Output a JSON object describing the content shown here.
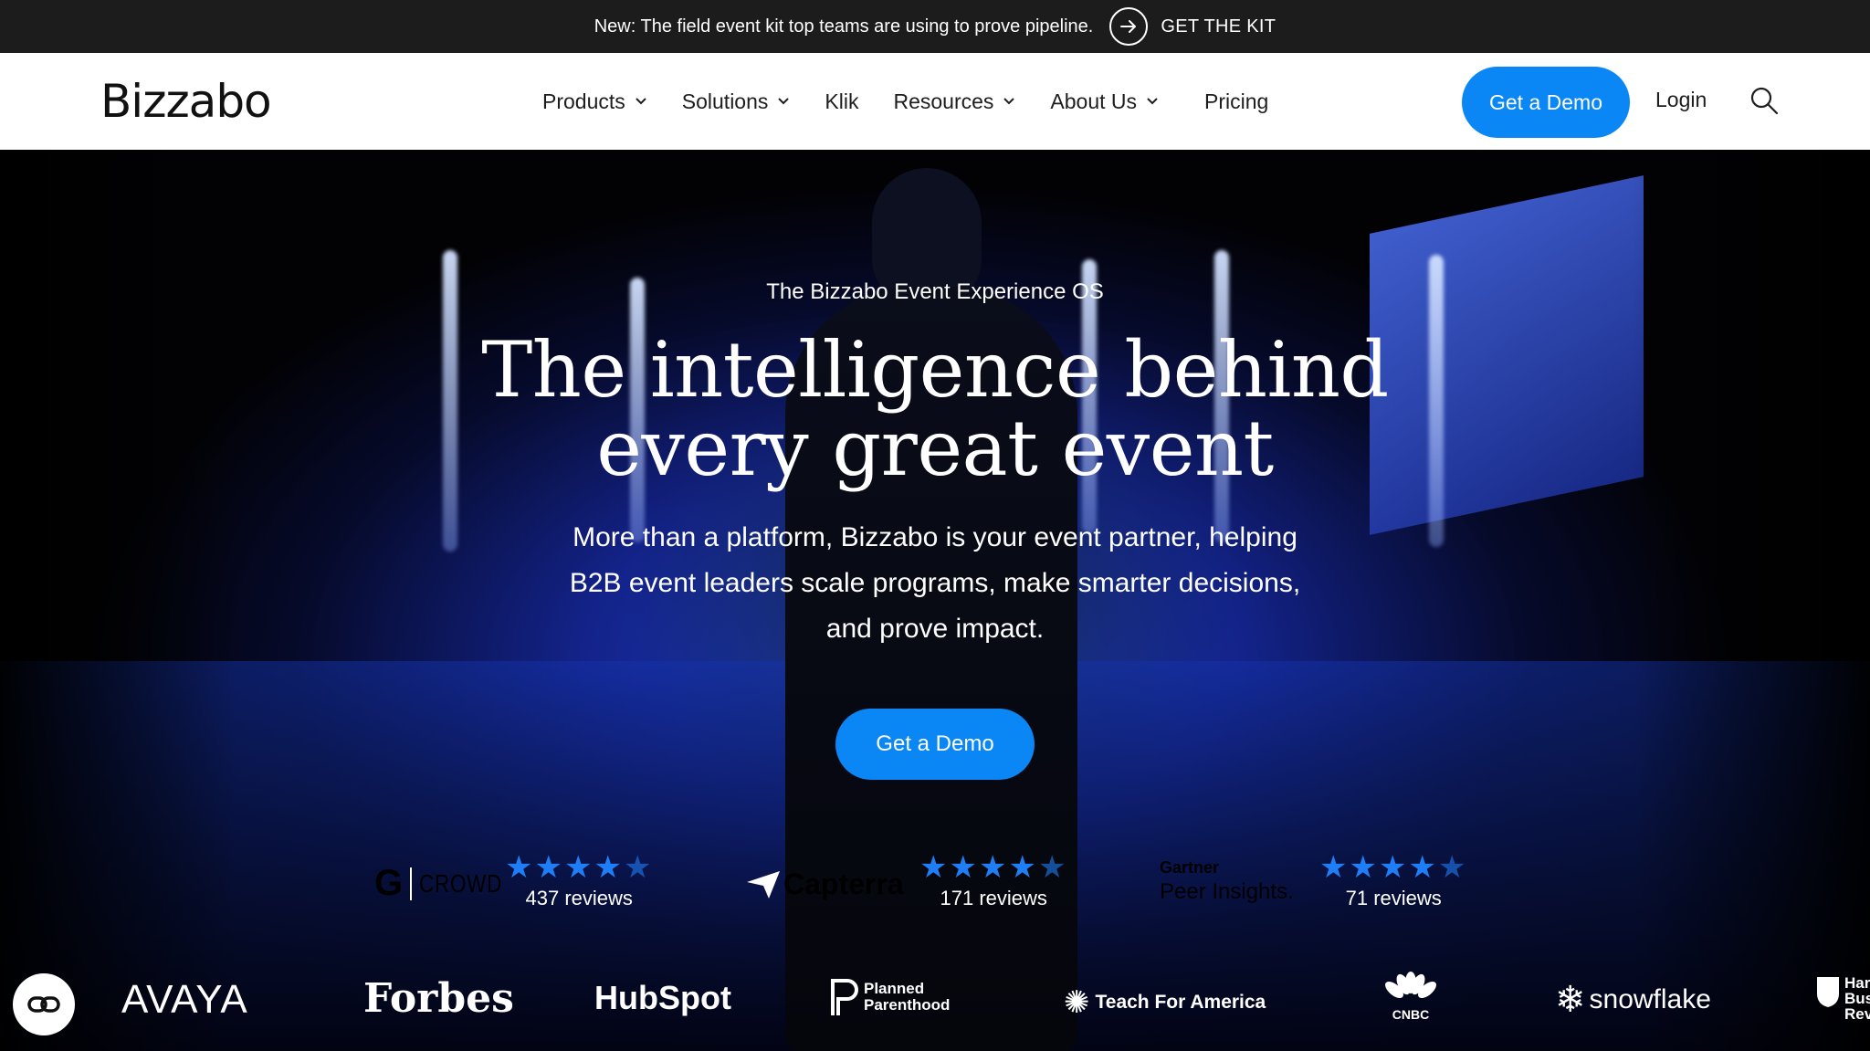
{
  "announcement": {
    "message": "New: The field event kit top teams are using to prove pipeline.",
    "cta": "GET THE KIT"
  },
  "header": {
    "logo": "Bizzabo",
    "nav": [
      {
        "label": "Products",
        "has_dropdown": true
      },
      {
        "label": "Solutions",
        "has_dropdown": true
      },
      {
        "label": "Klik",
        "has_dropdown": false
      },
      {
        "label": "Resources",
        "has_dropdown": true
      },
      {
        "label": "About Us",
        "has_dropdown": true
      },
      {
        "label": "Pricing",
        "has_dropdown": false
      }
    ],
    "demo_button": "Get a Demo",
    "login": "Login",
    "search_icon": "search-icon"
  },
  "hero": {
    "eyebrow": "The Bizzabo Event Experience OS",
    "headline_line1": "The intelligence behind",
    "headline_line2": "every great event",
    "sub_line1": "More than a platform, Bizzabo is your event partner, helping",
    "sub_line2": "B2B event leaders scale programs, make smarter decisions,",
    "sub_line3": "and prove impact.",
    "cta": "Get a Demo"
  },
  "ratings": [
    {
      "source": "G2 CROWD",
      "g2_mark": "G",
      "g2_wordmark": "CROWD",
      "stars": 4.5,
      "reviews": "437 reviews"
    },
    {
      "source": "Capterra",
      "stars": 4.5,
      "reviews": "171 reviews"
    },
    {
      "source": "Gartner Peer Insights",
      "gartner_label": "Gartner",
      "peer_label": "Peer Insights.",
      "stars": 4.5,
      "reviews": "71 reviews"
    }
  ],
  "logos": [
    "AVAYA",
    "Forbes",
    "HubSpot",
    "Planned Parenthood",
    "Teach For America",
    "CNBC",
    "snowflake",
    "Harvard Business Review"
  ],
  "logo_text": {
    "hubspot": "HubSpot",
    "pp_line1": "Planned",
    "pp_line2": "Parenthood",
    "tfa": "Teach For America",
    "cnbc": "CNBC",
    "snowflake": "snowflake",
    "hbr_line1": "Har",
    "hbr_line2": "Bus",
    "hbr_line3": "Rev"
  },
  "colors": {
    "accent": "#0b87f5",
    "star": "#1f7df5",
    "announce_bg": "#1c1c1c",
    "hero_blue": "#1d3cc4"
  }
}
